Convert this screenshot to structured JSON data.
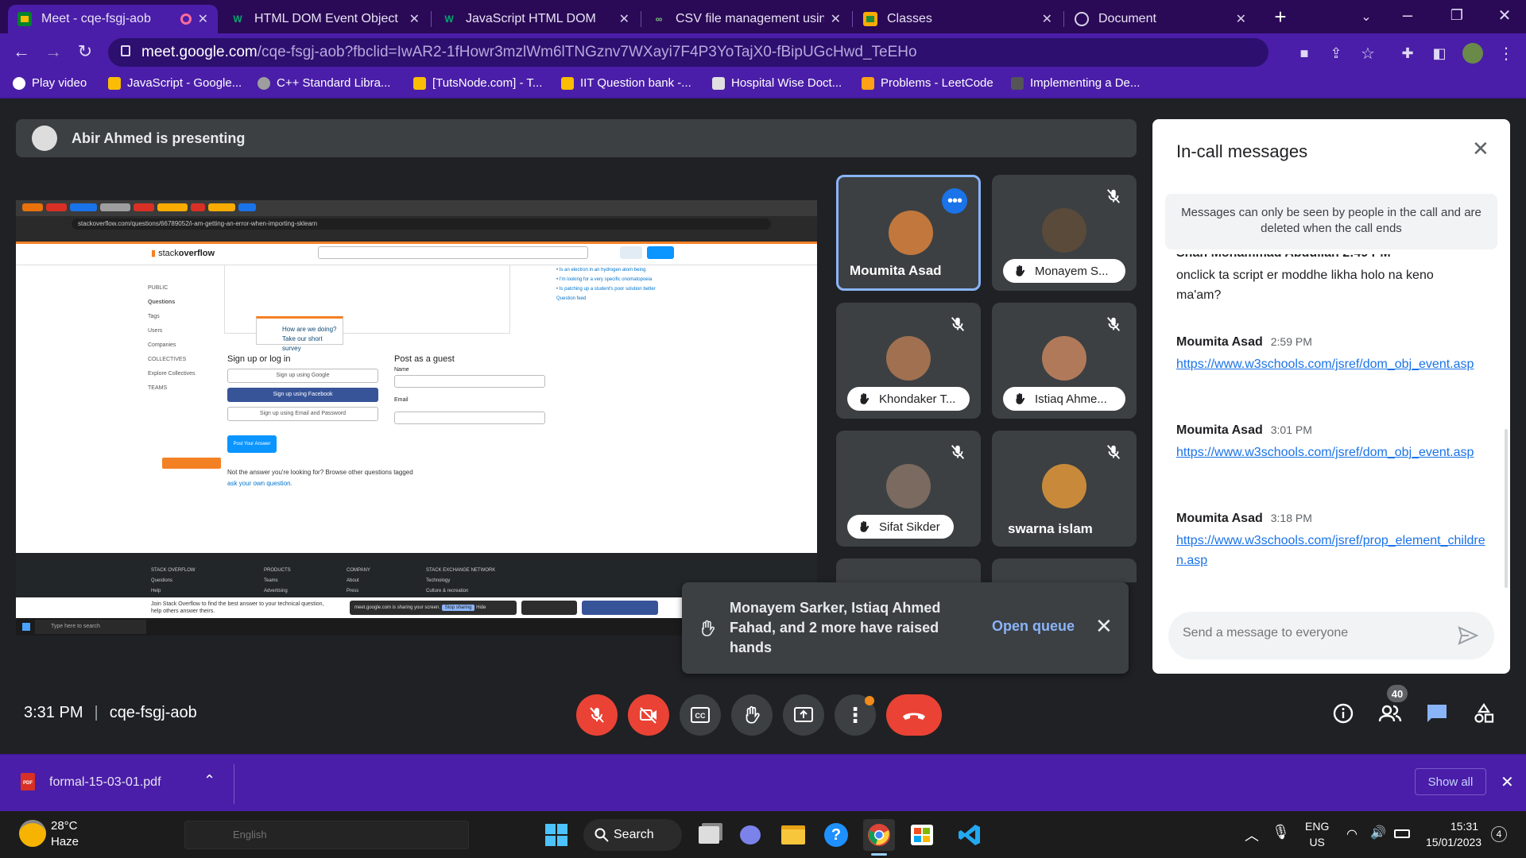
{
  "tabs": [
    {
      "label": "Meet - cqe-fsgj-aob",
      "icon": "google-meet-icon",
      "active": true
    },
    {
      "label": "HTML DOM Event Object",
      "icon": "w3schools-icon"
    },
    {
      "label": "JavaScript HTML DOM",
      "icon": "w3schools-icon"
    },
    {
      "label": "CSV file management using",
      "icon": "csv-site-icon"
    },
    {
      "label": "Classes",
      "icon": "google-classroom-icon"
    },
    {
      "label": "Document",
      "icon": "globe-icon"
    }
  ],
  "url": {
    "host": "meet.google.com",
    "path": "/cqe-fsgj-aob?fbclid=IwAR2-1fHowr3mzlWm6lTNGznv7WXayi7F4P3YoTajX0-fBipUGcHwd_TeEHo"
  },
  "bookmarks": [
    {
      "label": "Play video",
      "color": "#ffffff"
    },
    {
      "label": "JavaScript - Google...",
      "color": "#fbbc04"
    },
    {
      "label": "C++ Standard Libra...",
      "color": "#9e9e9e"
    },
    {
      "label": "[TutsNode.com] - T...",
      "color": "#fbbc04"
    },
    {
      "label": "IIT Question bank -...",
      "color": "#fbbc04"
    },
    {
      "label": "Hospital Wise Doct...",
      "color": "#e0e0e0"
    },
    {
      "label": "Problems - LeetCode",
      "color": "#ffa116"
    },
    {
      "label": "Implementing a De...",
      "color": "#555555"
    }
  ],
  "meet": {
    "presenter": "Abir Ahmed is presenting",
    "time": "3:31 PM",
    "meeting_code": "cqe-fsgj-aob",
    "participants_count": "40",
    "participants": [
      {
        "name": "Moumita Asad",
        "style": "name",
        "raised": false,
        "color": "#c2783c"
      },
      {
        "name": "Monayem S...",
        "style": "pill",
        "raised": true,
        "color": "#5a4a3a"
      },
      {
        "name": "Khondaker T...",
        "style": "pill",
        "raised": true,
        "color": "#a07050"
      },
      {
        "name": "Istiaq Ahme...",
        "style": "pill",
        "raised": true,
        "color": "#b07a5a"
      },
      {
        "name": "Sifat Sikder",
        "style": "pill",
        "raised": true,
        "color": "#7a6a60"
      },
      {
        "name": "swarna islam",
        "style": "name",
        "raised": false,
        "color": "#c88a3a"
      }
    ],
    "toast": {
      "text": "Monayem Sarker, Istiaq Ahmed Fahad, and 2 more have raised hands",
      "action": "Open queue"
    }
  },
  "panel": {
    "title": "In-call messages",
    "notice": "Messages can only be seen by people in the call and are deleted when the call ends",
    "partial_sender": "Shah Mohammad Abdullah  2:49 PM",
    "partial_text": "onclick ta script er moddhe likha holo na keno ma'am?",
    "messages": [
      {
        "sender": "Moumita Asad",
        "time": "2:59 PM",
        "text": "https://www.w3schools.com/jsref/dom_obj_event.asp"
      },
      {
        "sender": "Moumita Asad",
        "time": "3:01 PM",
        "text": "https://www.w3schools.com/jsref/dom_obj_event.asp"
      },
      {
        "sender": "Moumita Asad",
        "time": "3:18 PM",
        "text": "https://www.w3schools.com/jsref/prop_element_children.asp"
      }
    ],
    "input_placeholder": "Send a message to everyone"
  },
  "shared_screen": {
    "site": "stackoverflow",
    "url": "stackoverflow.com/questions/66789052/i-am-getting-an-error-when-importing-sklearn",
    "survey_title": "How are we doing?",
    "survey_sub": "Take our short survey",
    "signup_text": "Sign up or log in",
    "guest_text": "Post as a guest",
    "google_btn": "Sign up using Google",
    "facebook_btn": "Sign up using Facebook",
    "email_btn": "Sign up using Email and Password",
    "name_label": "Name",
    "email_label": "Email",
    "post_btn": "Post Your Answer",
    "browse_text": "Not the answer you're looking for? Browse other questions tagged",
    "ask_text": "ask your own question.",
    "sharing_text": "meet.google.com is sharing your screen.",
    "stop_sharing": "Stop sharing",
    "hide": "Hide",
    "join_text": "Join Stack Overflow to find the best answer to your technical question, help others answer theirs."
  },
  "download": {
    "filename": "formal-15-03-01.pdf",
    "show_all": "Show all"
  },
  "taskbar": {
    "temp": "28°C",
    "weather": "Haze",
    "search": "Search",
    "lang": "ENG",
    "region": "US",
    "clock": "15:31",
    "date": "15/01/2023",
    "notif": "4",
    "lang_pill": "English"
  }
}
